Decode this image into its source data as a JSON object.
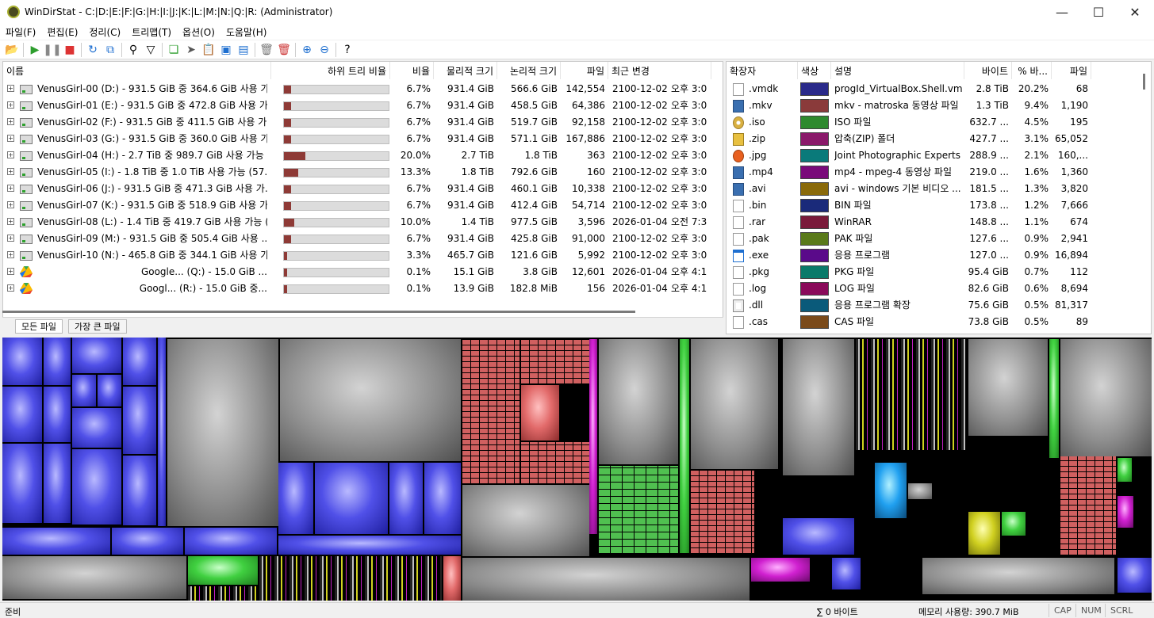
{
  "window": {
    "title": "WinDirStat - C:|D:|E:|F:|G:|H:|I:|J:|K:|L:|M:|N:|Q:|R:  (Administrator)"
  },
  "menu": [
    "파일(F)",
    "편집(E)",
    "정리(C)",
    "트리맵(T)",
    "옵션(O)",
    "도움말(H)"
  ],
  "tree": {
    "columns": [
      "이름",
      "하위 트리 비율",
      "비율",
      "물리적 크기",
      "논리적 크기",
      "파일",
      "최근 변경"
    ],
    "rows": [
      {
        "name": "VenusGirl-00 (D:) - 931.5 GiB 중 364.6 GiB 사용 가...",
        "ratio": 0.067,
        "pct": "6.7%",
        "phys": "931.4 GiB",
        "logical": "566.6 GiB",
        "files": "142,554",
        "date": "2100-12-02",
        "time": "오후 3:0"
      },
      {
        "name": "VenusGirl-01 (E:) - 931.5 GiB 중 472.8 GiB 사용 가...",
        "ratio": 0.067,
        "pct": "6.7%",
        "phys": "931.4 GiB",
        "logical": "458.5 GiB",
        "files": "64,386",
        "date": "2100-12-02",
        "time": "오후 3:0"
      },
      {
        "name": "VenusGirl-02 (F:) - 931.5 GiB 중 411.5 GiB 사용 가...",
        "ratio": 0.067,
        "pct": "6.7%",
        "phys": "931.4 GiB",
        "logical": "519.7 GiB",
        "files": "92,158",
        "date": "2100-12-02",
        "time": "오후 3:0"
      },
      {
        "name": "VenusGirl-03 (G:) - 931.5 GiB 중 360.0 GiB 사용 가...",
        "ratio": 0.067,
        "pct": "6.7%",
        "phys": "931.4 GiB",
        "logical": "571.1 GiB",
        "files": "167,886",
        "date": "2100-12-02",
        "time": "오후 3:0"
      },
      {
        "name": "VenusGirl-04 (H:) - 2.7 TiB 중 989.7 GiB 사용 가능 ...",
        "ratio": 0.2,
        "pct": "20.0%",
        "phys": "2.7 TiB",
        "logical": "1.8 TiB",
        "files": "363",
        "date": "2100-12-02",
        "time": "오후 3:0"
      },
      {
        "name": "VenusGirl-05 (I:) - 1.8 TiB 중 1.0 TiB 사용 가능 (57....",
        "ratio": 0.133,
        "pct": "13.3%",
        "phys": "1.8 TiB",
        "logical": "792.6 GiB",
        "files": "160",
        "date": "2100-12-02",
        "time": "오후 3:0"
      },
      {
        "name": "VenusGirl-06 (J:) - 931.5 GiB 중 471.3 GiB 사용 가...",
        "ratio": 0.067,
        "pct": "6.7%",
        "phys": "931.4 GiB",
        "logical": "460.1 GiB",
        "files": "10,338",
        "date": "2100-12-02",
        "time": "오후 3:0"
      },
      {
        "name": "VenusGirl-07 (K:) - 931.5 GiB 중 518.9 GiB 사용 가...",
        "ratio": 0.067,
        "pct": "6.7%",
        "phys": "931.4 GiB",
        "logical": "412.4 GiB",
        "files": "54,714",
        "date": "2100-12-02",
        "time": "오후 3:0"
      },
      {
        "name": "VenusGirl-08 (L:) - 1.4 TiB 중 419.7 GiB 사용 가능 (...",
        "ratio": 0.1,
        "pct": "10.0%",
        "phys": "1.4 TiB",
        "logical": "977.5 GiB",
        "files": "3,596",
        "date": "2026-01-04",
        "time": "오전 7:3"
      },
      {
        "name": "VenusGirl-09 (M:) - 931.5 GiB 중 505.4 GiB 사용 ...",
        "ratio": 0.067,
        "pct": "6.7%",
        "phys": "931.4 GiB",
        "logical": "425.8 GiB",
        "files": "91,000",
        "date": "2100-12-02",
        "time": "오후 3:0"
      },
      {
        "name": "VenusGirl-10 (N:) - 465.8 GiB 중 344.1 GiB 사용 가...",
        "ratio": 0.033,
        "pct": "3.3%",
        "phys": "465.7 GiB",
        "logical": "121.6 GiB",
        "files": "5,992",
        "date": "2100-12-02",
        "time": "오후 3:0"
      },
      {
        "name": "Google... (Q:) - 15.0 GiB ...",
        "ratio": 0.001,
        "pct": "0.1%",
        "phys": "15.1 GiB",
        "logical": "3.8 GiB",
        "files": "12,601",
        "date": "2026-01-04",
        "time": "오후 4:1"
      },
      {
        "name": "Googl... (R:) - 15.0 GiB 중...",
        "ratio": 0.001,
        "pct": "0.1%",
        "phys": "13.9 GiB",
        "logical": "182.8 MiB",
        "files": "156",
        "date": "2026-01-04",
        "time": "오후 4:1"
      }
    ]
  },
  "tabs": [
    "모든 파일",
    "가장 큰 파일"
  ],
  "ext": {
    "columns": [
      "확장자",
      "색상",
      "설명",
      "바이트",
      "% 바...",
      "파일"
    ],
    "rows": [
      {
        "ext": ".vmdk",
        "color": "#2a2a8a",
        "desc": "progId_VirtualBox.Shell.vmdk",
        "bytes": "2.8 TiB",
        "pct": "20.2%",
        "files": "68",
        "icon": "file-icon"
      },
      {
        "ext": ".mkv",
        "color": "#8a3a3a",
        "desc": "mkv - matroska 동영상 파일",
        "bytes": "1.3 TiB",
        "pct": "9.4%",
        "files": "1,190",
        "icon": "video-icon"
      },
      {
        "ext": ".iso",
        "color": "#2e8a2e",
        "desc": "ISO 파일",
        "bytes": "632.7 ...",
        "pct": "4.5%",
        "files": "195",
        "icon": "disc-icon"
      },
      {
        "ext": ".zip",
        "color": "#8a1a6a",
        "desc": "압축(ZIP) 폴더",
        "bytes": "427.7 ...",
        "pct": "3.1%",
        "files": "65,052",
        "icon": "zip-icon"
      },
      {
        "ext": ".jpg",
        "color": "#0a7a7a",
        "desc": "Joint Photographic Experts ...",
        "bytes": "288.9 ...",
        "pct": "2.1%",
        "files": "160,...",
        "icon": "image-icon"
      },
      {
        "ext": ".mp4",
        "color": "#7a0a7a",
        "desc": "mp4 - mpeg-4 동영상 파일",
        "bytes": "219.0 ...",
        "pct": "1.6%",
        "files": "1,360",
        "icon": "video-icon"
      },
      {
        "ext": ".avi",
        "color": "#8a6a0a",
        "desc": "avi - windows 기본 비디오 ...",
        "bytes": "181.5 ...",
        "pct": "1.3%",
        "files": "3,820",
        "icon": "video-icon"
      },
      {
        "ext": ".bin",
        "color": "#1a2a7a",
        "desc": "BIN 파일",
        "bytes": "173.8 ...",
        "pct": "1.2%",
        "files": "7,666",
        "icon": "file-icon"
      },
      {
        "ext": ".rar",
        "color": "#7a1a3a",
        "desc": "WinRAR",
        "bytes": "148.8 ...",
        "pct": "1.1%",
        "files": "674",
        "icon": "file-icon"
      },
      {
        "ext": ".pak",
        "color": "#5a7a1a",
        "desc": "PAK 파일",
        "bytes": "127.6 ...",
        "pct": "0.9%",
        "files": "2,941",
        "icon": "file-icon"
      },
      {
        "ext": ".exe",
        "color": "#5a0a8a",
        "desc": "응용 프로그램",
        "bytes": "127.0 ...",
        "pct": "0.9%",
        "files": "16,894",
        "icon": "exe-icon"
      },
      {
        "ext": ".pkg",
        "color": "#0a7a6a",
        "desc": "PKG 파일",
        "bytes": "95.4 GiB",
        "pct": "0.7%",
        "files": "112",
        "icon": "file-icon"
      },
      {
        "ext": ".log",
        "color": "#8a0a5a",
        "desc": "LOG 파일",
        "bytes": "82.6 GiB",
        "pct": "0.6%",
        "files": "8,694",
        "icon": "file-icon"
      },
      {
        "ext": ".dll",
        "color": "#0a5a7a",
        "desc": "응용 프로그램 확장",
        "bytes": "75.6 GiB",
        "pct": "0.5%",
        "files": "81,317",
        "icon": "dll-icon"
      },
      {
        "ext": ".cas",
        "color": "#7a4a1a",
        "desc": "CAS 파일",
        "bytes": "73.8 GiB",
        "pct": "0.5%",
        "files": "89",
        "icon": "file-icon"
      }
    ]
  },
  "status": {
    "ready": "준비",
    "sum": "∑ 0 바이트",
    "memory": "메모리 사용량: 390.7 MiB",
    "cap": "CAP",
    "num": "NUM",
    "scrl": "SCRL"
  }
}
